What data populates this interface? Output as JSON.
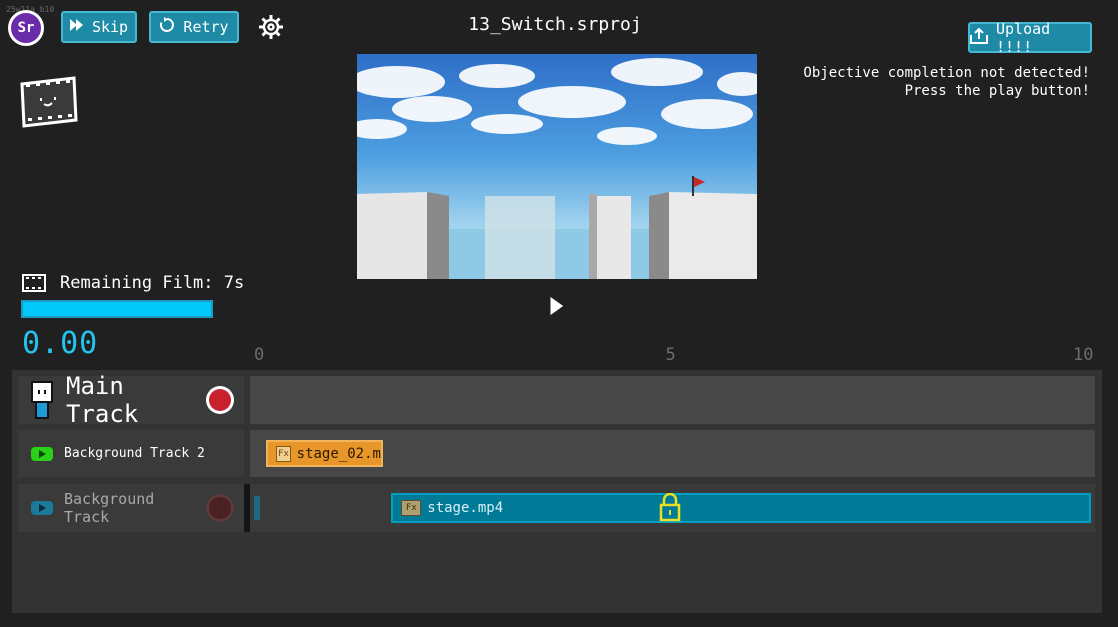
{
  "app": {
    "logo_text": "Sr",
    "version_text": "25w11a_b10",
    "project_title": "13_Switch.srproj"
  },
  "toolbar": {
    "skip_label": "Skip",
    "retry_label": "Retry",
    "settings_icon": "gear-icon",
    "upload_label": "Upload !!!!"
  },
  "objective": {
    "line1": "Objective completion not detected!",
    "line2": "Press the play button!"
  },
  "film": {
    "label": "Remaining Film: 7s",
    "remaining_fraction": 1.0,
    "time": "0.00"
  },
  "ruler": {
    "min": 0,
    "max": 10,
    "ticks": [
      "0",
      "5",
      "10"
    ]
  },
  "tracks": {
    "main": {
      "label": "Main Track",
      "record_color": "#c8202c"
    },
    "bg2": {
      "label": "Background Track 2",
      "clip_label": "stage_02.m",
      "clip_start": 0.1,
      "clip_end": 1.5,
      "fx_label": "Fx"
    },
    "bg1": {
      "label": "Background Track",
      "clip_label": "stage.mp4",
      "clip_start": 1.6,
      "clip_end": 10.0,
      "fx_label": "Fx"
    }
  },
  "colors": {
    "accent": "#1e8aa6",
    "film_bar": "#00b8e8",
    "time_text": "#22c4f0",
    "clip_orange": "#e8962a",
    "clip_teal": "#007a96",
    "lock": "#e8e020"
  }
}
